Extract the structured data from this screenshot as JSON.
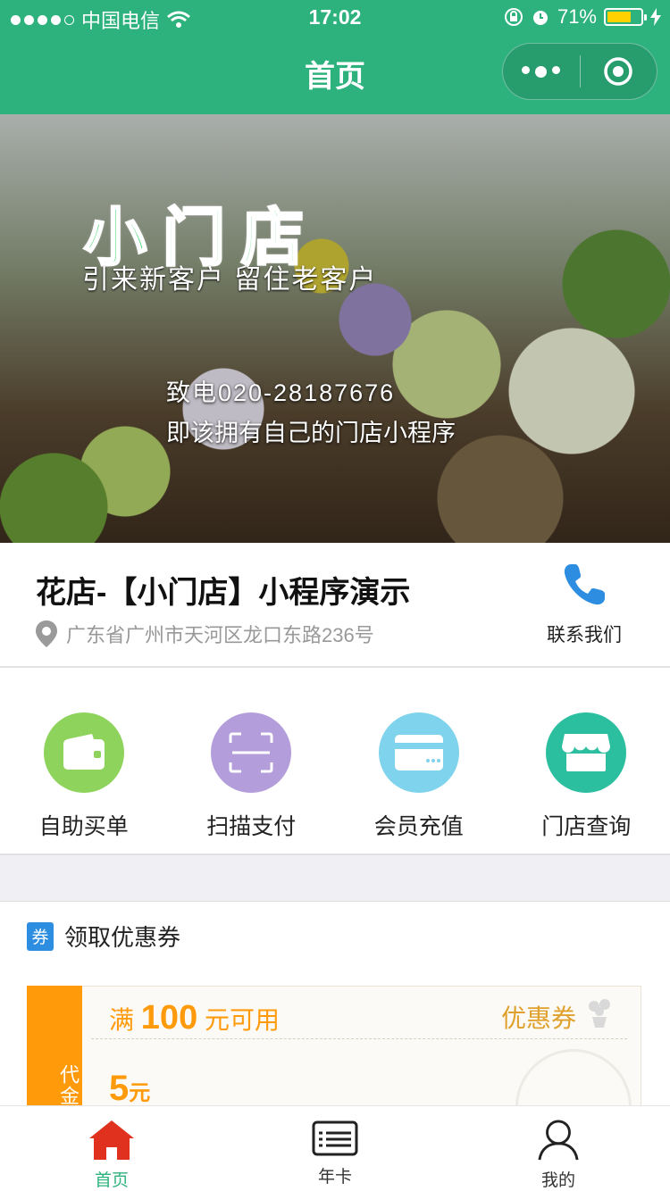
{
  "status_bar": {
    "carrier": "中国电信",
    "time": "17:02",
    "battery": "71%"
  },
  "nav": {
    "title": "首页"
  },
  "banner": {
    "brand": "小门店",
    "slogan": "引来新客户 留住老客户",
    "promo_phone": "致电020-28187676",
    "promo_text": "即该拥有自己的门店小程序"
  },
  "shop": {
    "name": "花店-【小门店】小程序演示",
    "address": "广东省广州市天河区龙口东路236号",
    "contact_label": "联系我们"
  },
  "actions": [
    {
      "label": "自助买单",
      "icon": "wallet-icon",
      "color": "#8ed35b"
    },
    {
      "label": "扫描支付",
      "icon": "scan-icon",
      "color": "#b39ddb"
    },
    {
      "label": "会员充值",
      "icon": "card-icon",
      "color": "#7fd3ec"
    },
    {
      "label": "门店查询",
      "icon": "store-icon",
      "color": "#2bbfa0"
    }
  ],
  "coupons": {
    "section_icon": "券",
    "section_title": "领取优惠券",
    "items": [
      {
        "tag": "代金券",
        "condition_prefix": "满",
        "condition_amount": "100",
        "condition_suffix": "元可用",
        "title": "优惠券",
        "amount": "5",
        "amount_unit": "元"
      }
    ]
  },
  "tabs": [
    {
      "label": "首页",
      "icon": "home-icon",
      "active": true
    },
    {
      "label": "年卡",
      "icon": "card-list-icon",
      "active": false
    },
    {
      "label": "我的",
      "icon": "user-icon",
      "active": false
    }
  ],
  "colors": {
    "primary": "#2db27d",
    "accent": "#ff9a0a",
    "home_tab": "#e0301e"
  }
}
